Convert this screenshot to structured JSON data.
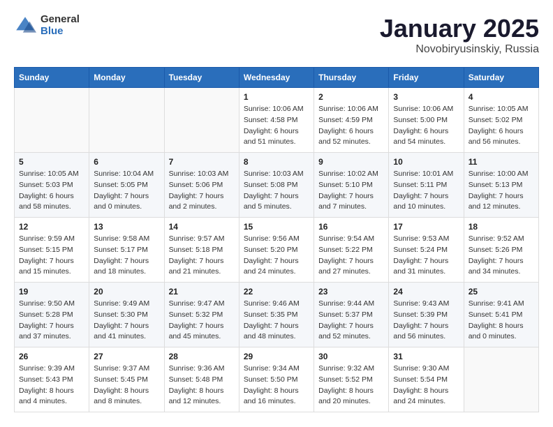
{
  "header": {
    "logo_general": "General",
    "logo_blue": "Blue",
    "title": "January 2025",
    "location": "Novobiryusinskiy, Russia"
  },
  "days_of_week": [
    "Sunday",
    "Monday",
    "Tuesday",
    "Wednesday",
    "Thursday",
    "Friday",
    "Saturday"
  ],
  "weeks": [
    [
      {
        "day": "",
        "info": ""
      },
      {
        "day": "",
        "info": ""
      },
      {
        "day": "",
        "info": ""
      },
      {
        "day": "1",
        "info": "Sunrise: 10:06 AM\nSunset: 4:58 PM\nDaylight: 6 hours\nand 51 minutes."
      },
      {
        "day": "2",
        "info": "Sunrise: 10:06 AM\nSunset: 4:59 PM\nDaylight: 6 hours\nand 52 minutes."
      },
      {
        "day": "3",
        "info": "Sunrise: 10:06 AM\nSunset: 5:00 PM\nDaylight: 6 hours\nand 54 minutes."
      },
      {
        "day": "4",
        "info": "Sunrise: 10:05 AM\nSunset: 5:02 PM\nDaylight: 6 hours\nand 56 minutes."
      }
    ],
    [
      {
        "day": "5",
        "info": "Sunrise: 10:05 AM\nSunset: 5:03 PM\nDaylight: 6 hours\nand 58 minutes."
      },
      {
        "day": "6",
        "info": "Sunrise: 10:04 AM\nSunset: 5:05 PM\nDaylight: 7 hours\nand 0 minutes."
      },
      {
        "day": "7",
        "info": "Sunrise: 10:03 AM\nSunset: 5:06 PM\nDaylight: 7 hours\nand 2 minutes."
      },
      {
        "day": "8",
        "info": "Sunrise: 10:03 AM\nSunset: 5:08 PM\nDaylight: 7 hours\nand 5 minutes."
      },
      {
        "day": "9",
        "info": "Sunrise: 10:02 AM\nSunset: 5:10 PM\nDaylight: 7 hours\nand 7 minutes."
      },
      {
        "day": "10",
        "info": "Sunrise: 10:01 AM\nSunset: 5:11 PM\nDaylight: 7 hours\nand 10 minutes."
      },
      {
        "day": "11",
        "info": "Sunrise: 10:00 AM\nSunset: 5:13 PM\nDaylight: 7 hours\nand 12 minutes."
      }
    ],
    [
      {
        "day": "12",
        "info": "Sunrise: 9:59 AM\nSunset: 5:15 PM\nDaylight: 7 hours\nand 15 minutes."
      },
      {
        "day": "13",
        "info": "Sunrise: 9:58 AM\nSunset: 5:17 PM\nDaylight: 7 hours\nand 18 minutes."
      },
      {
        "day": "14",
        "info": "Sunrise: 9:57 AM\nSunset: 5:18 PM\nDaylight: 7 hours\nand 21 minutes."
      },
      {
        "day": "15",
        "info": "Sunrise: 9:56 AM\nSunset: 5:20 PM\nDaylight: 7 hours\nand 24 minutes."
      },
      {
        "day": "16",
        "info": "Sunrise: 9:54 AM\nSunset: 5:22 PM\nDaylight: 7 hours\nand 27 minutes."
      },
      {
        "day": "17",
        "info": "Sunrise: 9:53 AM\nSunset: 5:24 PM\nDaylight: 7 hours\nand 31 minutes."
      },
      {
        "day": "18",
        "info": "Sunrise: 9:52 AM\nSunset: 5:26 PM\nDaylight: 7 hours\nand 34 minutes."
      }
    ],
    [
      {
        "day": "19",
        "info": "Sunrise: 9:50 AM\nSunset: 5:28 PM\nDaylight: 7 hours\nand 37 minutes."
      },
      {
        "day": "20",
        "info": "Sunrise: 9:49 AM\nSunset: 5:30 PM\nDaylight: 7 hours\nand 41 minutes."
      },
      {
        "day": "21",
        "info": "Sunrise: 9:47 AM\nSunset: 5:32 PM\nDaylight: 7 hours\nand 45 minutes."
      },
      {
        "day": "22",
        "info": "Sunrise: 9:46 AM\nSunset: 5:35 PM\nDaylight: 7 hours\nand 48 minutes."
      },
      {
        "day": "23",
        "info": "Sunrise: 9:44 AM\nSunset: 5:37 PM\nDaylight: 7 hours\nand 52 minutes."
      },
      {
        "day": "24",
        "info": "Sunrise: 9:43 AM\nSunset: 5:39 PM\nDaylight: 7 hours\nand 56 minutes."
      },
      {
        "day": "25",
        "info": "Sunrise: 9:41 AM\nSunset: 5:41 PM\nDaylight: 8 hours\nand 0 minutes."
      }
    ],
    [
      {
        "day": "26",
        "info": "Sunrise: 9:39 AM\nSunset: 5:43 PM\nDaylight: 8 hours\nand 4 minutes."
      },
      {
        "day": "27",
        "info": "Sunrise: 9:37 AM\nSunset: 5:45 PM\nDaylight: 8 hours\nand 8 minutes."
      },
      {
        "day": "28",
        "info": "Sunrise: 9:36 AM\nSunset: 5:48 PM\nDaylight: 8 hours\nand 12 minutes."
      },
      {
        "day": "29",
        "info": "Sunrise: 9:34 AM\nSunset: 5:50 PM\nDaylight: 8 hours\nand 16 minutes."
      },
      {
        "day": "30",
        "info": "Sunrise: 9:32 AM\nSunset: 5:52 PM\nDaylight: 8 hours\nand 20 minutes."
      },
      {
        "day": "31",
        "info": "Sunrise: 9:30 AM\nSunset: 5:54 PM\nDaylight: 8 hours\nand 24 minutes."
      },
      {
        "day": "",
        "info": ""
      }
    ]
  ]
}
